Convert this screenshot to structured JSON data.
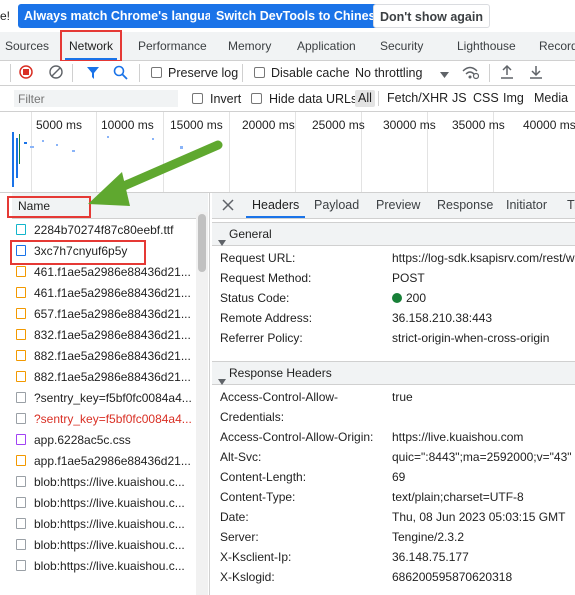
{
  "infobar": {
    "lead_text": "e!",
    "match_language_label": "Always match Chrome's language",
    "switch_chinese_label": "Switch DevTools to Chinese",
    "dont_show_label": "Don't show again"
  },
  "panel_tabs": [
    "Sources",
    "Network",
    "Performance",
    "Memory",
    "Application",
    "Security",
    "Lighthouse",
    "Record"
  ],
  "toolbar": {
    "preserve_log": "Preserve log",
    "disable_cache": "Disable cache",
    "throttling": "No throttling"
  },
  "filterbar": {
    "placeholder": "Filter",
    "invert": "Invert",
    "hide_data_urls": "Hide data URLs",
    "types": [
      "All",
      "Fetch/XHR",
      "JS",
      "CSS",
      "Img",
      "Media"
    ]
  },
  "timeline": {
    "ticks": [
      "5000 ms",
      "10000 ms",
      "15000 ms",
      "20000 ms",
      "25000 ms",
      "30000 ms",
      "35000 ms",
      "40000 ms"
    ]
  },
  "request_list": {
    "header": "Name",
    "rows": [
      "2284b70274f87c80eebf.ttf",
      "3xc7h7cnyuf6p5y",
      "461.f1ae5a2986e88436d21...",
      "461.f1ae5a2986e88436d21...",
      "657.f1ae5a2986e88436d21...",
      "832.f1ae5a2986e88436d21...",
      "882.f1ae5a2986e88436d21...",
      "882.f1ae5a2986e88436d21...",
      "?sentry_key=f5bf0fc0084a4...",
      "?sentry_key=f5bf0fc0084a4...",
      "app.6228ac5c.css",
      "app.f1ae5a2986e88436d21...",
      "blob:https://live.kuaishou.c...",
      "blob:https://live.kuaishou.c...",
      "blob:https://live.kuaishou.c...",
      "blob:https://live.kuaishou.c...",
      "blob:https://live.kuaishou.c..."
    ]
  },
  "details": {
    "tabs": [
      "Headers",
      "Payload",
      "Preview",
      "Response",
      "Initiator",
      "Ti"
    ],
    "general_title": "General",
    "general": [
      {
        "key": "Request URL:",
        "value": "https://log-sdk.ksapisrv.com/rest/w"
      },
      {
        "key": "Request Method:",
        "value": "POST"
      },
      {
        "key": "Status Code:",
        "value": "200"
      },
      {
        "key": "Remote Address:",
        "value": "36.158.210.38:443"
      },
      {
        "key": "Referrer Policy:",
        "value": "strict-origin-when-cross-origin"
      }
    ],
    "response_title": "Response Headers",
    "response": [
      {
        "key": "Access-Control-Allow-",
        "key2": "Credentials:",
        "value": "true"
      },
      {
        "key": "Access-Control-Allow-Origin:",
        "value": "https://live.kuaishou.com"
      },
      {
        "key": "Alt-Svc:",
        "value": "quic=\":8443\";ma=2592000;v=\"43\""
      },
      {
        "key": "Content-Length:",
        "value": "69"
      },
      {
        "key": "Content-Type:",
        "value": "text/plain;charset=UTF-8"
      },
      {
        "key": "Date:",
        "value": "Thu, 08 Jun 2023 05:03:15 GMT"
      },
      {
        "key": "Server:",
        "value": "Tengine/2.3.2"
      },
      {
        "key": "X-Ksclient-Ip:",
        "value": "36.148.75.177"
      },
      {
        "key": "X-Kslogid:",
        "value": "686200595870620318"
      }
    ]
  },
  "colors": {
    "accent": "#1a73e8",
    "highlight_box": "#e53935",
    "arrow": "#5fa82f",
    "status_ok": "#188038",
    "error_text": "#d93025"
  }
}
